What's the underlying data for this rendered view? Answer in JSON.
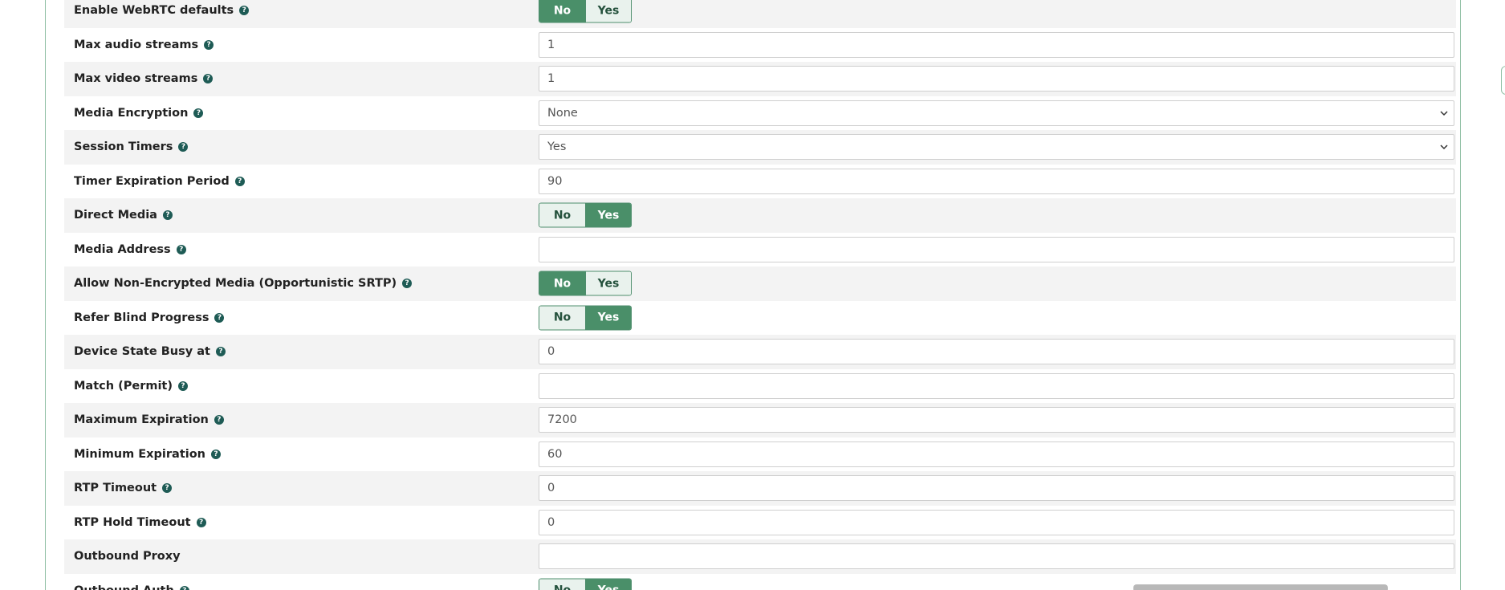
{
  "rows": [
    {
      "label": "Enable WebRTC defaults",
      "type": "toggle",
      "options": [
        "No",
        "Yes"
      ],
      "selected": "No",
      "help_icon": "question-circle-icon"
    },
    {
      "label": "Max audio streams",
      "type": "text",
      "value": "1"
    },
    {
      "label": "Max video streams",
      "type": "text",
      "value": "1"
    },
    {
      "label": "Media Encryption",
      "type": "select",
      "value": "None"
    },
    {
      "label": "Session Timers",
      "type": "select",
      "value": "Yes"
    },
    {
      "label": "Timer Expiration Period",
      "type": "text",
      "value": "90"
    },
    {
      "label": "Direct Media",
      "type": "toggle",
      "options": [
        "No",
        "Yes"
      ],
      "selected": "Yes"
    },
    {
      "label": "Media Address",
      "type": "text",
      "value": ""
    },
    {
      "label": "Allow Non-Encrypted Media (Opportunistic SRTP)",
      "type": "toggle",
      "options": [
        "No",
        "Yes"
      ],
      "selected": "No"
    },
    {
      "label": "Refer Blind Progress",
      "type": "toggle",
      "options": [
        "No",
        "Yes"
      ],
      "selected": "Yes"
    },
    {
      "label": "Device State Busy at",
      "type": "text",
      "value": "0"
    },
    {
      "label": "Match (Permit)",
      "type": "text",
      "value": ""
    },
    {
      "label": "Maximum Expiration",
      "type": "text",
      "value": "7200"
    },
    {
      "label": "Minimum Expiration",
      "type": "text",
      "value": "60"
    },
    {
      "label": "RTP Timeout",
      "type": "text",
      "value": "0"
    },
    {
      "label": "RTP Hold Timeout",
      "type": "text",
      "value": "0"
    },
    {
      "label": "Outbound Proxy",
      "type": "text",
      "value": "",
      "no_help": true
    },
    {
      "label": "Outbound Auth",
      "type": "toggle",
      "options": [
        "No",
        "Yes"
      ],
      "selected": "Yes"
    }
  ],
  "help_glyph": "?",
  "colors": {
    "toggle_active": "#4a8f69",
    "toggle_inactive": "#e9f2ed",
    "help_icon": "#1e5b55",
    "row_shade": "#f3f3f3",
    "panel_border": "#8fbfa4"
  }
}
